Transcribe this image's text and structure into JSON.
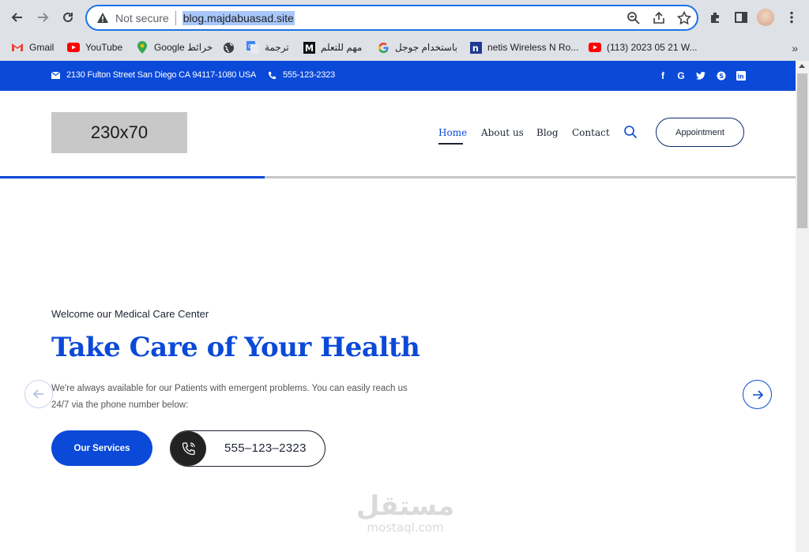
{
  "browser": {
    "security_label": "Not secure",
    "url": "blog.majdabuasad.site",
    "bookmarks": [
      {
        "label": "Gmail",
        "icon": "gmail-icon"
      },
      {
        "label": "YouTube",
        "icon": "youtube-icon"
      },
      {
        "label": "Google خرائط",
        "icon": "maps-icon"
      },
      {
        "label": "",
        "icon": "globe-icon"
      },
      {
        "label": "ترجمة",
        "icon": "translate-icon"
      },
      {
        "label": "مهم للتعلم",
        "icon": "bookmark-m-icon"
      },
      {
        "label": "باستخدام جوجل",
        "icon": "google-icon"
      },
      {
        "label": "netis Wireless N Ro...",
        "icon": "netis-icon"
      },
      {
        "label": "(113) 2023 05 21 W...",
        "icon": "youtube-icon"
      }
    ],
    "more_label": "»"
  },
  "topbar": {
    "address": "2130 Fulton Street San Diego CA 94117-1080 USA",
    "phone": "555-123-2323",
    "social": [
      "facebook-icon",
      "google-icon",
      "twitter-icon",
      "skype-icon",
      "linkedin-icon"
    ],
    "social_glyphs": [
      "f",
      "G",
      "t",
      "S",
      "in"
    ]
  },
  "header": {
    "logo_placeholder": "230x70",
    "nav": [
      "Home",
      "About us",
      "Blog",
      "Contact"
    ],
    "active_nav": "Home",
    "appointment_label": "Appointment"
  },
  "slider": {
    "progress": 0.333
  },
  "hero": {
    "subtitle": "Welcome our Medical Care Center",
    "title": "Take Care of Your Health",
    "description": "We're always available for our Patients with emergent problems. You can easily reach us 24/7 via the phone number below:",
    "services_label": "Our Services",
    "phone": "555–123–2323"
  },
  "watermark": {
    "arabic": "مستقل",
    "latin": "mostaql.com"
  },
  "colors": {
    "brand": "#0b49d8",
    "dark": "#1d2433",
    "chrome": "#dee1e6"
  }
}
